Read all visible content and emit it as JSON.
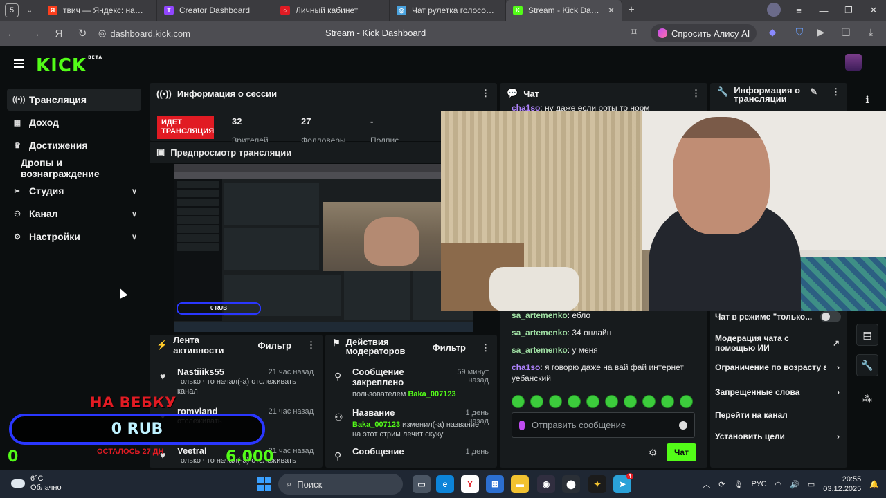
{
  "browser": {
    "tab_count": "5",
    "tabs": [
      {
        "title": "твич — Яндекс: нашлось",
        "fav_color": "#fc3f1d",
        "fav_text": "Я",
        "active": false
      },
      {
        "title": "Creator Dashboard",
        "fav_color": "#9146ff",
        "fav_text": "T",
        "active": false
      },
      {
        "title": "Личный кабинет",
        "fav_color": "#e11b23",
        "fav_text": "○",
        "active": false
      },
      {
        "title": "Чат рулетка голосовая —",
        "fav_color": "#4aa3df",
        "fav_text": "◎",
        "active": false
      },
      {
        "title": "Stream - Kick Dashboar",
        "fav_color": "#53fc18",
        "fav_text": "K",
        "active": true
      }
    ],
    "url": "dashboard.kick.com",
    "page_title": "Stream - Kick Dashboard",
    "alice_label": "Спросить Алису AI"
  },
  "kick": {
    "logo": "KICK",
    "logo_beta": "BETA",
    "sidebar": [
      {
        "label": "Трансляция",
        "icon": "broadcast-icon",
        "glyph": "((•))",
        "active": true,
        "chevron": false
      },
      {
        "label": "Доход",
        "icon": "income-icon",
        "glyph": "▦",
        "active": false,
        "chevron": false
      },
      {
        "label": "Достижения",
        "icon": "trophy-icon",
        "glyph": "♛",
        "active": false,
        "chevron": false
      },
      {
        "label": "Дропы и вознаграждение",
        "icon": "",
        "glyph": "",
        "active": false,
        "chevron": false
      },
      {
        "label": "Студия",
        "icon": "studio-icon",
        "glyph": "✂",
        "active": false,
        "chevron": true
      },
      {
        "label": "Канал",
        "icon": "channel-icon",
        "glyph": "⚇",
        "active": false,
        "chevron": true
      },
      {
        "label": "Настройки",
        "icon": "settings-icon",
        "glyph": "⚙",
        "active": false,
        "chevron": true
      }
    ],
    "session": {
      "title": "Информация о сессии",
      "live_badge": "ИДЕТ ТРАНСЛЯЦИЯ",
      "stats": [
        {
          "value": "32",
          "label": "Зрителей"
        },
        {
          "value": "27",
          "label": "Фолловеры"
        },
        {
          "value": "-",
          "label": "Подпис"
        }
      ]
    },
    "preview": {
      "title": "Предпросмотр трансляции"
    },
    "chat": {
      "title": "Чат",
      "top_message": {
        "user": "cha1so",
        "text": ": ну даже если роты то норм"
      },
      "messages": [
        {
          "user": "sa_artemenko",
          "text": ": ебло",
          "color": "green"
        },
        {
          "user": "sa_artemenko",
          "text": ": 34 онлайн",
          "color": "green"
        },
        {
          "user": "sa_artemenko",
          "text": ": у меня",
          "color": "green"
        },
        {
          "user": "cha1so",
          "text": ": я говорю даже на вай фай интернет уебанский",
          "color": "purple"
        }
      ],
      "input_placeholder": "Отправить сообщение",
      "send_label": "Чат"
    },
    "stream_info": {
      "title": "Информация о трансляции",
      "rows": [
        {
          "label": "Чат в режиме \"только...",
          "kind": "toggle"
        },
        {
          "label": "Модерация чата с помощью ИИ",
          "kind": "external"
        },
        {
          "label": "Ограничение по возрасту а",
          "kind": "arrow"
        },
        {
          "label": "Запрещенные слова",
          "kind": "arrow"
        },
        {
          "label": "Перейти на канал",
          "kind": "none"
        },
        {
          "label": "Установить цели",
          "kind": "arrow"
        }
      ]
    },
    "activity": {
      "title": "Лента активности",
      "filter": "Фильтр",
      "items": [
        {
          "name": "Nastiiiks55",
          "time": "21 час назад",
          "text": "только что начал(-а) отслеживать канал"
        },
        {
          "name": "romyland",
          "time": "21 час назад",
          "text": "отслеживать"
        },
        {
          "name": "Veetral",
          "time": "21 час назад",
          "text": "только что начал(-а) отслеживать"
        }
      ]
    },
    "mod_actions": {
      "title": "Действия модераторов",
      "filter": "Фильтр",
      "items": [
        {
          "title": "Сообщение закреплено",
          "time": "59 минут назад",
          "text_prefix": "пользователем ",
          "user": "Baka_007123",
          "text_suffix": ""
        },
        {
          "title": "Название",
          "time": "1 день назад",
          "text_prefix": "",
          "user": "Baka_007123",
          "text_suffix": " изменил(-а) название на этот стрим лечит скуку"
        },
        {
          "title": "Сообщение",
          "time": "1 день",
          "text_prefix": "",
          "user": "",
          "text_suffix": ""
        }
      ]
    }
  },
  "overlay": {
    "title": "НА ВЕБКУ",
    "amount": "0 RUB",
    "left_value": "0",
    "right_value": "6.000",
    "remaining": "ОСТАЛОСЬ 27 ДН"
  },
  "taskbar": {
    "temp": "6°C",
    "weather": "Облачно",
    "search": "Поиск",
    "lang": "РУС",
    "time": "20:55",
    "date": "03.12.2025",
    "telegram_badge": "4"
  }
}
